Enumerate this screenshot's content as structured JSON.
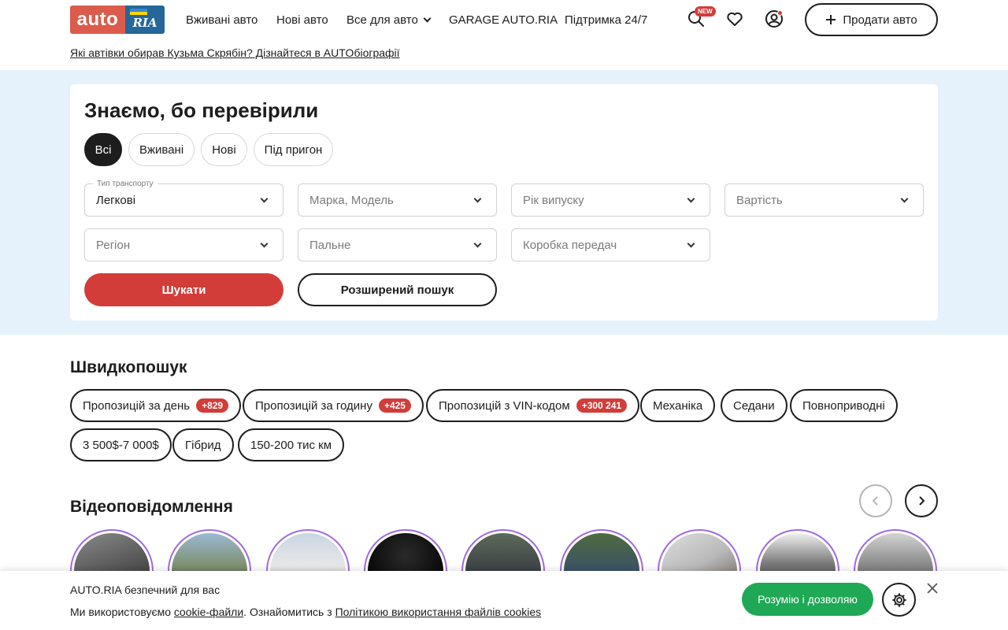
{
  "header": {
    "logo_left": "auto",
    "logo_right": "RIA",
    "nav": [
      "Вживані авто",
      "Нові авто",
      "Все для авто",
      "GARAGE AUTO.RIA",
      "Підтримка 24/7"
    ],
    "new_badge": "NEW",
    "sell_label": "Продати авто",
    "promo": "Які автівки обирав Кузьма Скрябін? Дізнайтеся в AUTOбіографії"
  },
  "search": {
    "title": "Знаємо, бо перевірили",
    "tabs": [
      "Всі",
      "Вживані",
      "Нові",
      "Під пригон"
    ],
    "transport_label": "Тип транспорту",
    "transport_value": "Легкові",
    "brand": "Марка, Модель",
    "year": "Рік випуску",
    "price": "Вартість",
    "region": "Регіон",
    "fuel": "Пальне",
    "gearbox": "Коробка передач",
    "search_btn": "Шукати",
    "advanced_btn": "Розширений пошук"
  },
  "quick": {
    "title": "Швидкопошук",
    "chips": [
      {
        "label": "Пропозицій за день",
        "count": "+829"
      },
      {
        "label": "Пропозицій за годину",
        "count": "+425"
      },
      {
        "label": "Пропозицій з VIN-кодом",
        "count": "+300 241"
      },
      {
        "label": "Механіка"
      },
      {
        "label": "Седани"
      },
      {
        "label": "Повноприводні"
      },
      {
        "label": "3 500$-7 000$"
      },
      {
        "label": "Гібрид"
      },
      {
        "label": "150-200 тис км"
      }
    ]
  },
  "video": {
    "title": "Відеоповідомлення"
  },
  "cookie": {
    "title": "AUTO.RIA безпечний для вас",
    "text_1": "Ми використовуємо ",
    "link_1": "cookie-файли",
    "text_2": ". Ознайомитись з ",
    "link_2": "Політикою використання файлів cookies",
    "accept": "Розумію і дозволяю"
  },
  "colors": {
    "red": "#d23d39",
    "green": "#1fa855",
    "band": "#e6f2fb",
    "story_ring": "#a06be0"
  }
}
